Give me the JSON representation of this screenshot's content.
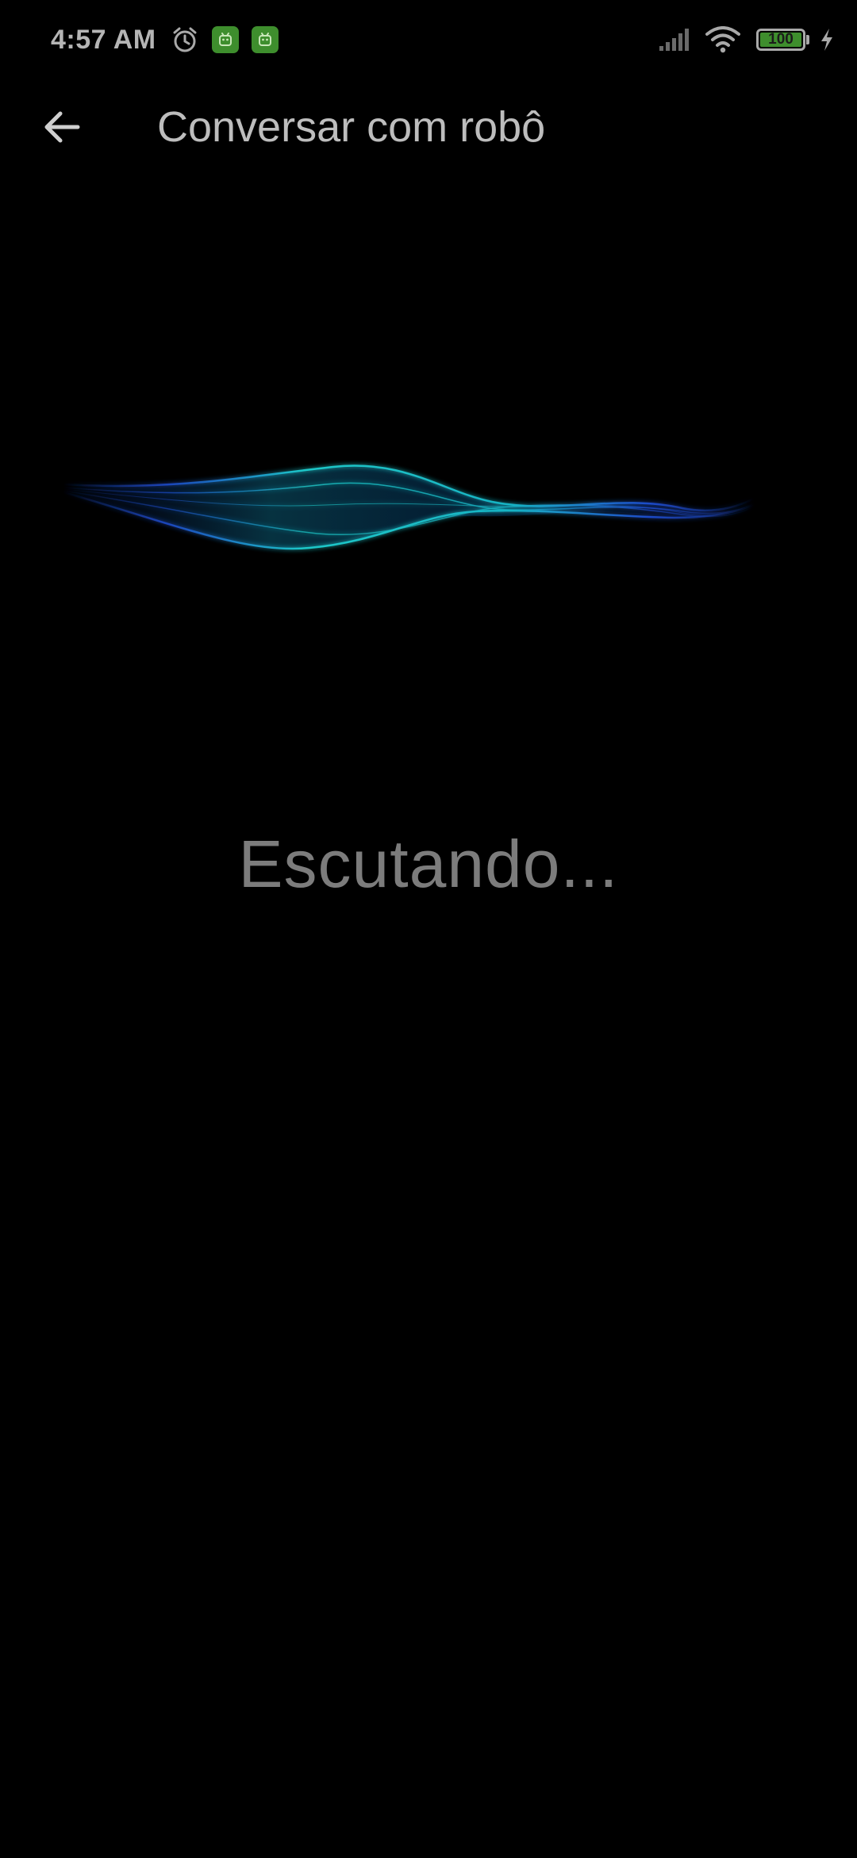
{
  "status_bar": {
    "time": "4:57 AM",
    "battery_level": "100",
    "icons": [
      "alarm-clock-icon",
      "app-notification-icon",
      "app-notification-icon",
      "cell-signal-icon",
      "wifi-icon",
      "battery-icon",
      "charging-icon"
    ]
  },
  "header": {
    "back_icon": "arrow-left-icon",
    "title": "Conversar com robô"
  },
  "voice": {
    "status": "Escutando..."
  },
  "colors": {
    "background": "#000000",
    "title_text": "#bdbdbd",
    "status_text": "#7c7c7c",
    "wave_cyan": "#1ec8c8",
    "wave_blue": "#1f4fd6",
    "badge_green": "#3e8e2d"
  }
}
